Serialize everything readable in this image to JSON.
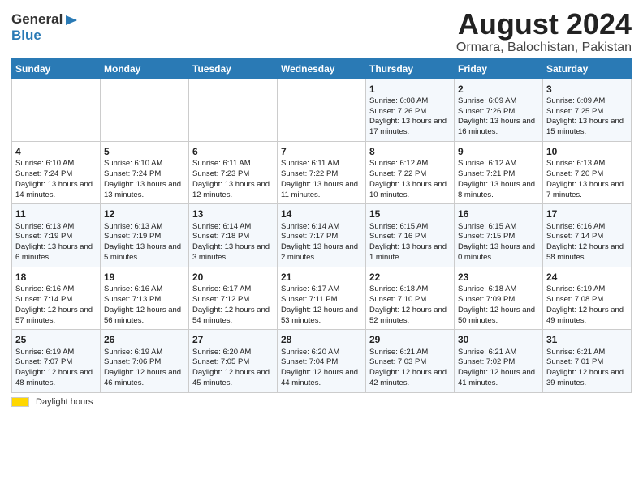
{
  "header": {
    "logo_general": "General",
    "logo_blue": "Blue",
    "title": "August 2024",
    "subtitle": "Ormara, Balochistan, Pakistan"
  },
  "weekdays": [
    "Sunday",
    "Monday",
    "Tuesday",
    "Wednesday",
    "Thursday",
    "Friday",
    "Saturday"
  ],
  "weeks": [
    [
      {
        "day": "",
        "sunrise": "",
        "sunset": "",
        "daylight": ""
      },
      {
        "day": "",
        "sunrise": "",
        "sunset": "",
        "daylight": ""
      },
      {
        "day": "",
        "sunrise": "",
        "sunset": "",
        "daylight": ""
      },
      {
        "day": "",
        "sunrise": "",
        "sunset": "",
        "daylight": ""
      },
      {
        "day": "1",
        "sunrise": "Sunrise: 6:08 AM",
        "sunset": "Sunset: 7:26 PM",
        "daylight": "Daylight: 13 hours and 17 minutes."
      },
      {
        "day": "2",
        "sunrise": "Sunrise: 6:09 AM",
        "sunset": "Sunset: 7:26 PM",
        "daylight": "Daylight: 13 hours and 16 minutes."
      },
      {
        "day": "3",
        "sunrise": "Sunrise: 6:09 AM",
        "sunset": "Sunset: 7:25 PM",
        "daylight": "Daylight: 13 hours and 15 minutes."
      }
    ],
    [
      {
        "day": "4",
        "sunrise": "Sunrise: 6:10 AM",
        "sunset": "Sunset: 7:24 PM",
        "daylight": "Daylight: 13 hours and 14 minutes."
      },
      {
        "day": "5",
        "sunrise": "Sunrise: 6:10 AM",
        "sunset": "Sunset: 7:24 PM",
        "daylight": "Daylight: 13 hours and 13 minutes."
      },
      {
        "day": "6",
        "sunrise": "Sunrise: 6:11 AM",
        "sunset": "Sunset: 7:23 PM",
        "daylight": "Daylight: 13 hours and 12 minutes."
      },
      {
        "day": "7",
        "sunrise": "Sunrise: 6:11 AM",
        "sunset": "Sunset: 7:22 PM",
        "daylight": "Daylight: 13 hours and 11 minutes."
      },
      {
        "day": "8",
        "sunrise": "Sunrise: 6:12 AM",
        "sunset": "Sunset: 7:22 PM",
        "daylight": "Daylight: 13 hours and 10 minutes."
      },
      {
        "day": "9",
        "sunrise": "Sunrise: 6:12 AM",
        "sunset": "Sunset: 7:21 PM",
        "daylight": "Daylight: 13 hours and 8 minutes."
      },
      {
        "day": "10",
        "sunrise": "Sunrise: 6:13 AM",
        "sunset": "Sunset: 7:20 PM",
        "daylight": "Daylight: 13 hours and 7 minutes."
      }
    ],
    [
      {
        "day": "11",
        "sunrise": "Sunrise: 6:13 AM",
        "sunset": "Sunset: 7:19 PM",
        "daylight": "Daylight: 13 hours and 6 minutes."
      },
      {
        "day": "12",
        "sunrise": "Sunrise: 6:13 AM",
        "sunset": "Sunset: 7:19 PM",
        "daylight": "Daylight: 13 hours and 5 minutes."
      },
      {
        "day": "13",
        "sunrise": "Sunrise: 6:14 AM",
        "sunset": "Sunset: 7:18 PM",
        "daylight": "Daylight: 13 hours and 3 minutes."
      },
      {
        "day": "14",
        "sunrise": "Sunrise: 6:14 AM",
        "sunset": "Sunset: 7:17 PM",
        "daylight": "Daylight: 13 hours and 2 minutes."
      },
      {
        "day": "15",
        "sunrise": "Sunrise: 6:15 AM",
        "sunset": "Sunset: 7:16 PM",
        "daylight": "Daylight: 13 hours and 1 minute."
      },
      {
        "day": "16",
        "sunrise": "Sunrise: 6:15 AM",
        "sunset": "Sunset: 7:15 PM",
        "daylight": "Daylight: 13 hours and 0 minutes."
      },
      {
        "day": "17",
        "sunrise": "Sunrise: 6:16 AM",
        "sunset": "Sunset: 7:14 PM",
        "daylight": "Daylight: 12 hours and 58 minutes."
      }
    ],
    [
      {
        "day": "18",
        "sunrise": "Sunrise: 6:16 AM",
        "sunset": "Sunset: 7:14 PM",
        "daylight": "Daylight: 12 hours and 57 minutes."
      },
      {
        "day": "19",
        "sunrise": "Sunrise: 6:16 AM",
        "sunset": "Sunset: 7:13 PM",
        "daylight": "Daylight: 12 hours and 56 minutes."
      },
      {
        "day": "20",
        "sunrise": "Sunrise: 6:17 AM",
        "sunset": "Sunset: 7:12 PM",
        "daylight": "Daylight: 12 hours and 54 minutes."
      },
      {
        "day": "21",
        "sunrise": "Sunrise: 6:17 AM",
        "sunset": "Sunset: 7:11 PM",
        "daylight": "Daylight: 12 hours and 53 minutes."
      },
      {
        "day": "22",
        "sunrise": "Sunrise: 6:18 AM",
        "sunset": "Sunset: 7:10 PM",
        "daylight": "Daylight: 12 hours and 52 minutes."
      },
      {
        "day": "23",
        "sunrise": "Sunrise: 6:18 AM",
        "sunset": "Sunset: 7:09 PM",
        "daylight": "Daylight: 12 hours and 50 minutes."
      },
      {
        "day": "24",
        "sunrise": "Sunrise: 6:19 AM",
        "sunset": "Sunset: 7:08 PM",
        "daylight": "Daylight: 12 hours and 49 minutes."
      }
    ],
    [
      {
        "day": "25",
        "sunrise": "Sunrise: 6:19 AM",
        "sunset": "Sunset: 7:07 PM",
        "daylight": "Daylight: 12 hours and 48 minutes."
      },
      {
        "day": "26",
        "sunrise": "Sunrise: 6:19 AM",
        "sunset": "Sunset: 7:06 PM",
        "daylight": "Daylight: 12 hours and 46 minutes."
      },
      {
        "day": "27",
        "sunrise": "Sunrise: 6:20 AM",
        "sunset": "Sunset: 7:05 PM",
        "daylight": "Daylight: 12 hours and 45 minutes."
      },
      {
        "day": "28",
        "sunrise": "Sunrise: 6:20 AM",
        "sunset": "Sunset: 7:04 PM",
        "daylight": "Daylight: 12 hours and 44 minutes."
      },
      {
        "day": "29",
        "sunrise": "Sunrise: 6:21 AM",
        "sunset": "Sunset: 7:03 PM",
        "daylight": "Daylight: 12 hours and 42 minutes."
      },
      {
        "day": "30",
        "sunrise": "Sunrise: 6:21 AM",
        "sunset": "Sunset: 7:02 PM",
        "daylight": "Daylight: 12 hours and 41 minutes."
      },
      {
        "day": "31",
        "sunrise": "Sunrise: 6:21 AM",
        "sunset": "Sunset: 7:01 PM",
        "daylight": "Daylight: 12 hours and 39 minutes."
      }
    ]
  ],
  "footer": {
    "swatch_label": "Daylight hours"
  }
}
